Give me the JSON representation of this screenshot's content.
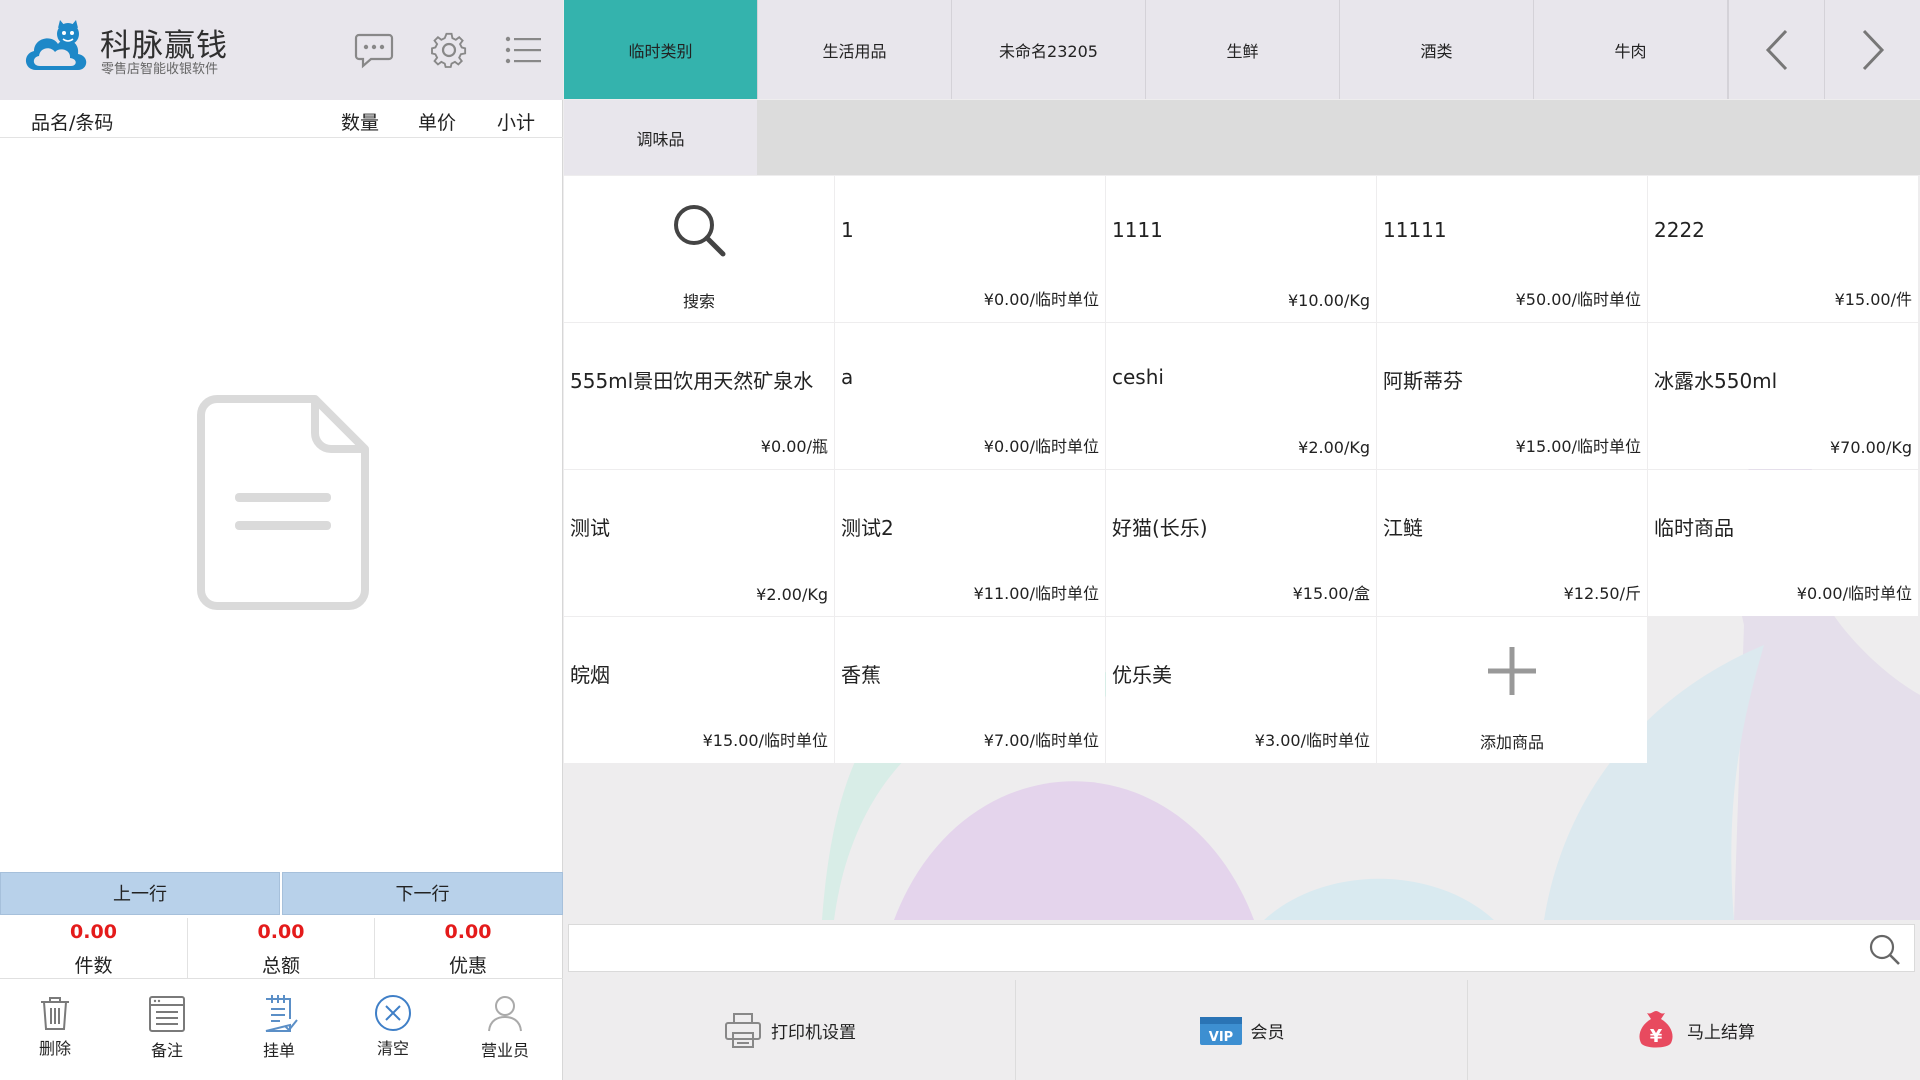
{
  "brand": {
    "name": "科脉赢钱",
    "subtitle": "零售店智能收银软件"
  },
  "cart": {
    "columns": {
      "name": "品名/条码",
      "qty": "数量",
      "price": "单价",
      "subtotal": "小计"
    },
    "prev_label": "上一行",
    "next_label": "下一行",
    "stats": [
      {
        "value": "0.00",
        "label": "件数"
      },
      {
        "value": "0.00",
        "label": "总额"
      },
      {
        "value": "0.00",
        "label": "优惠"
      }
    ],
    "actions": [
      "删除",
      "备注",
      "挂单",
      "清空",
      "营业员"
    ]
  },
  "categories": {
    "row1": [
      "临时类别",
      "生活用品",
      "未命名23205",
      "生鲜",
      "酒类",
      "牛肉"
    ],
    "active_index": 0,
    "row2": [
      "调味品"
    ]
  },
  "tiles": {
    "search_label": "搜索",
    "add_label": "添加商品",
    "products": [
      {
        "name": "1",
        "price": "¥0.00/临时单位"
      },
      {
        "name": "1111",
        "price": "¥10.00/Kg"
      },
      {
        "name": "11111",
        "price": "¥50.00/临时单位"
      },
      {
        "name": "2222",
        "price": "¥15.00/件"
      },
      {
        "name": "555ml景田饮用天然矿泉水",
        "price": "¥0.00/瓶"
      },
      {
        "name": "a",
        "price": "¥0.00/临时单位"
      },
      {
        "name": "ceshi",
        "price": "¥2.00/Kg"
      },
      {
        "name": "阿斯蒂芬",
        "price": "¥15.00/临时单位"
      },
      {
        "name": "冰露水550ml",
        "price": "¥70.00/Kg"
      },
      {
        "name": "测试",
        "price": "¥2.00/Kg"
      },
      {
        "name": "测试2",
        "price": "¥11.00/临时单位"
      },
      {
        "name": "好猫(长乐)",
        "price": "¥15.00/盒"
      },
      {
        "name": "江鲢",
        "price": "¥12.50/斤"
      },
      {
        "name": "临时商品",
        "price": "¥0.00/临时单位"
      },
      {
        "name": "皖烟",
        "price": "¥15.00/临时单位"
      },
      {
        "name": "香蕉",
        "price": "¥7.00/临时单位"
      },
      {
        "name": "优乐美",
        "price": "¥3.00/临时单位"
      }
    ]
  },
  "search": {
    "placeholder": ""
  },
  "bottom": {
    "print_label": "打印机设置",
    "vip_label": "会员",
    "vip_badge": "VIP",
    "checkout_label": "马上结算"
  },
  "colors": {
    "accent": "#34b3ad",
    "stat_value": "#e41b1b",
    "nav_button": "#b8d1ea"
  }
}
